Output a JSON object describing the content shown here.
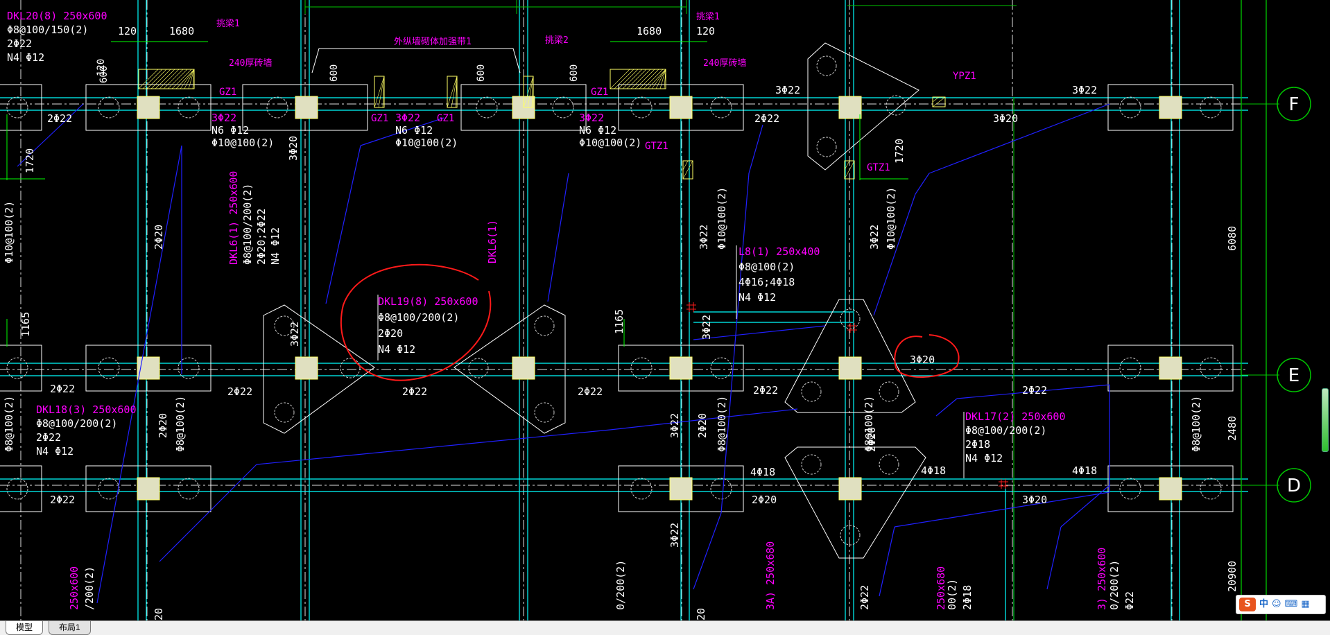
{
  "tabs": [
    {
      "label": "模型",
      "active": true
    },
    {
      "label": "布局1",
      "active": false
    }
  ],
  "ime": {
    "logo": "S",
    "mode": "中",
    "icons": [
      "smile-icon",
      "keyboard-icon",
      "grid-icon"
    ]
  },
  "colors": {
    "background": "#000000",
    "grid": "#00c800",
    "beam": "#00ffff",
    "dim": "#00ff00",
    "label": "#ff00ff",
    "text": "#ffffff",
    "column": "#ffff66",
    "leader": "#2020ff",
    "markup": "#ff1a1a"
  },
  "axes": [
    {
      "label": "F"
    },
    {
      "label": "E"
    },
    {
      "label": "D"
    }
  ],
  "dims": {
    "top_left": "1680",
    "top_left_small": "120",
    "top_right": "1680",
    "top_right_small": "120",
    "left_1720": "1720",
    "right_1720": "1720",
    "left_1165": "1165",
    "mid_1165": "1165",
    "right_6080": "6080",
    "right_2480": "2480",
    "right_20900": "20900",
    "wall_600a": "600",
    "wall_600b": "600",
    "wall_600c": "600",
    "wall_600d": "600",
    "wall_120": "120"
  },
  "labels": {
    "dkl20": [
      "DKL20(8) 250x600",
      "Φ8@100/150(2)",
      "2Φ22",
      "N4 Φ12"
    ],
    "dkl19": [
      "DKL19(8) 250x600",
      "Φ8@100/200(2)",
      "2Φ20",
      "N4 Φ12"
    ],
    "dkl18": [
      "DKL18(3) 250x600",
      "Φ8@100/200(2)",
      "2Φ22",
      "N4 Φ12"
    ],
    "dkl17": [
      "DKL17(2) 250x600",
      "Φ8@100/200(2)",
      "2Φ18",
      "N4 Φ12"
    ],
    "l8": [
      "L8(1) 250x400",
      "Φ8@100(2)",
      "4Φ16;4Φ18",
      "N4 Φ12"
    ],
    "dkl6v": [
      "DKL6(1) 250x600",
      "Φ8@100/200(2)",
      "2Φ20;2Φ22",
      "N4 Φ12"
    ],
    "dkl6b": "DKL6(1)",
    "sec1": [
      "3Φ22",
      "N6 Φ12",
      "Φ10@100(2)"
    ],
    "sec2": [
      "3Φ22",
      "N6 Φ12",
      "Φ10@100(2)"
    ],
    "sec3": [
      "3Φ22",
      "N6 Φ12",
      "Φ10@100(2)"
    ],
    "gz": "GZ1",
    "gtz": "GTZ1",
    "ypz": "YPZ1",
    "tiao": "挑梁1",
    "tiao2": "挑梁2",
    "wall240": "240厚砖墙",
    "wallnote": "外纵墙砌体加强带1",
    "bars": {
      "r2_22": "2Φ22",
      "r3_22": "3Φ22",
      "r3_20": "3Φ20",
      "r2_20": "2Φ20",
      "r4_18": "4Φ18",
      "r3_20c": "3Φ20",
      "v3_20": "3Φ20",
      "v2_20": "2Φ20",
      "v3_22": "3Φ22",
      "v10": "Φ10@100(2)",
      "v8": "Φ8@100(2)"
    },
    "bottom": [
      "250x600",
      "/200(2)",
      "250x680",
      "3A) 250x680",
      "0/200(2)",
      "00(2)",
      "2Φ18",
      "3) 250x600",
      "0/200(2)",
      "Φ22",
      "2Φ22",
      "20",
      "20"
    ]
  }
}
